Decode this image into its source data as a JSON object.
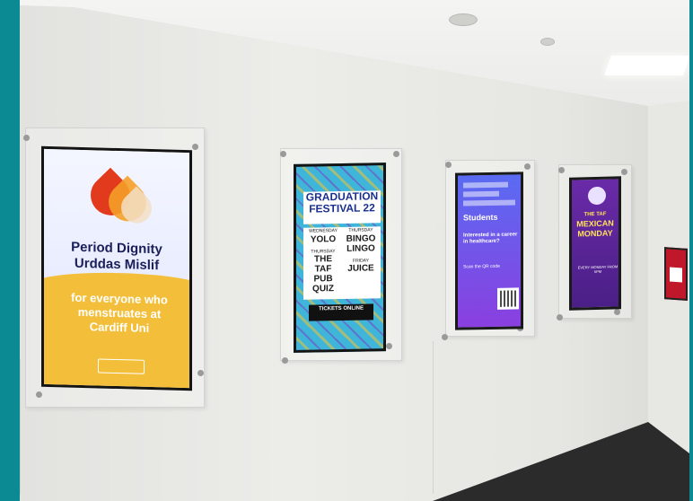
{
  "screen1": {
    "title_line1": "Period Dignity",
    "title_line2": "Urddas Mislif",
    "tagline_line1": "for everyone who",
    "tagline_line2": "menstruates at",
    "tagline_line3": "Cardiff Uni",
    "colors": {
      "red": "#e23a1c",
      "orange": "#f5a028",
      "yellow": "#f3bf3a",
      "navy": "#1a1f5a"
    }
  },
  "screen2": {
    "title_line1": "GRADUATION",
    "title_line2": "FESTIVAL 22",
    "col1": {
      "day1": "WEDNESDAY",
      "event1": "YOLO",
      "day2": "THURSDAY",
      "event2": "THE TAF PUB QUIZ"
    },
    "col2": {
      "day1": "THURSDAY",
      "event1": "BINGO LINGO",
      "day2": "FRIDAY",
      "event2": "JUICE"
    },
    "tickets": "TICKETS ONLINE",
    "colors": {
      "blue": "#3fb6d9",
      "yellow": "#f2c230",
      "purple": "#7a3dbf"
    }
  },
  "screen3": {
    "heading": "Students",
    "question": "Interested in a career in healthcare?",
    "cta": "Scan the QR code",
    "colors": {
      "top": "#5a6bf2",
      "bottom": "#8a3fe0"
    }
  },
  "screen4": {
    "line1": "THE TAF",
    "line2": "MEXICAN",
    "line3": "MONDAY",
    "note": "EVERY MONDAY FROM 5PM",
    "colors": {
      "purple": "#6a2aa8",
      "yellow": "#ffe05a"
    }
  }
}
